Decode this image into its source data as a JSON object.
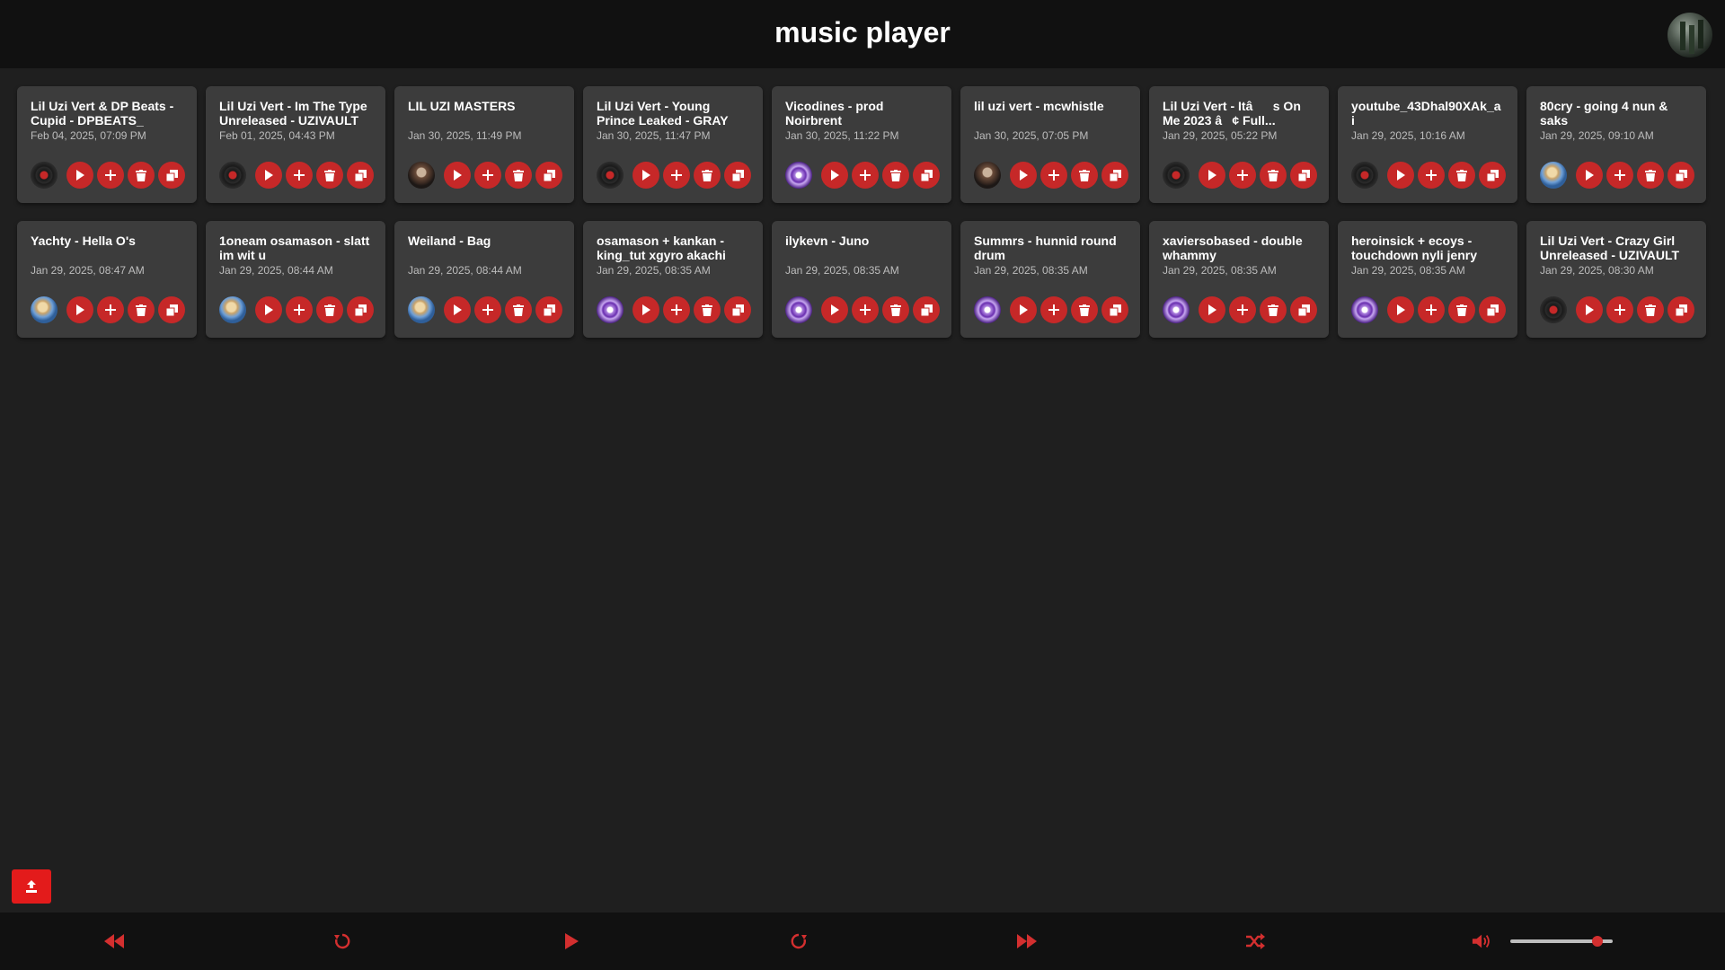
{
  "header": {
    "title": "music player"
  },
  "colors": {
    "accent": "#c62828",
    "background": "#1f1f1f",
    "card": "#3c3c3c",
    "bar": "#111111"
  },
  "tracks": [
    {
      "title": "Lil Uzi Vert & DP Beats - Cupid - DPBEATS_",
      "date": "Feb 04, 2025, 07:09 PM",
      "thumb": "vinyl"
    },
    {
      "title": "Lil Uzi Vert - Im The Type Unreleased - UZIVAULT",
      "date": "Feb 01, 2025, 04:43 PM",
      "thumb": "vinyl"
    },
    {
      "title": "LIL UZI MASTERS",
      "date": "Jan 30, 2025, 11:49 PM",
      "thumb": "portrait"
    },
    {
      "title": "Lil Uzi Vert - Young Prince Leaked - GRAY",
      "date": "Jan 30, 2025, 11:47 PM",
      "thumb": "vinyl"
    },
    {
      "title": "Vicodines - prod Noirbrent",
      "date": "Jan 30, 2025, 11:22 PM",
      "thumb": "eye"
    },
    {
      "title": "lil uzi vert - mcwhistle",
      "date": "Jan 30, 2025, 07:05 PM",
      "thumb": "portrait"
    },
    {
      "title": "Lil Uzi Vert - Itâs On Me 2023 â¢ Full...",
      "date": "Jan 29, 2025, 05:22 PM",
      "thumb": "vinyl"
    },
    {
      "title": "youtube_43Dhal90XAk_ai",
      "date": "Jan 29, 2025, 10:16 AM",
      "thumb": "vinyl"
    },
    {
      "title": "80cry - going 4 nun & saks",
      "date": "Jan 29, 2025, 09:10 AM",
      "thumb": "sky"
    },
    {
      "title": "Yachty - Hella O's",
      "date": "Jan 29, 2025, 08:47 AM",
      "thumb": "sky"
    },
    {
      "title": "1oneam osamason - slatt im wit u",
      "date": "Jan 29, 2025, 08:44 AM",
      "thumb": "sky"
    },
    {
      "title": "Weiland - Bag",
      "date": "Jan 29, 2025, 08:44 AM",
      "thumb": "sky"
    },
    {
      "title": "osamason + kankan - king_tut xgyro akachi",
      "date": "Jan 29, 2025, 08:35 AM",
      "thumb": "eye"
    },
    {
      "title": "ilykevn - Juno",
      "date": "Jan 29, 2025, 08:35 AM",
      "thumb": "eye"
    },
    {
      "title": "Summrs - hunnid round drum",
      "date": "Jan 29, 2025, 08:35 AM",
      "thumb": "eye"
    },
    {
      "title": "xaviersobased - double whammy",
      "date": "Jan 29, 2025, 08:35 AM",
      "thumb": "eye"
    },
    {
      "title": "heroinsick + ecoys - touchdown nyli jenry",
      "date": "Jan 29, 2025, 08:35 AM",
      "thumb": "eye"
    },
    {
      "title": "Lil Uzi Vert - Crazy Girl Unreleased - UZIVAULT",
      "date": "Jan 29, 2025, 08:30 AM",
      "thumb": "vinyl"
    }
  ],
  "card_actions": [
    "play-icon",
    "plus-icon",
    "trash-icon",
    "copy-icon"
  ],
  "player": {
    "controls": [
      "rewind-icon",
      "replay-icon",
      "play-icon",
      "forward-step-icon",
      "fast-forward-icon",
      "shuffle-icon"
    ],
    "volume_icon": "volume-icon",
    "volume_level": 0.85
  }
}
